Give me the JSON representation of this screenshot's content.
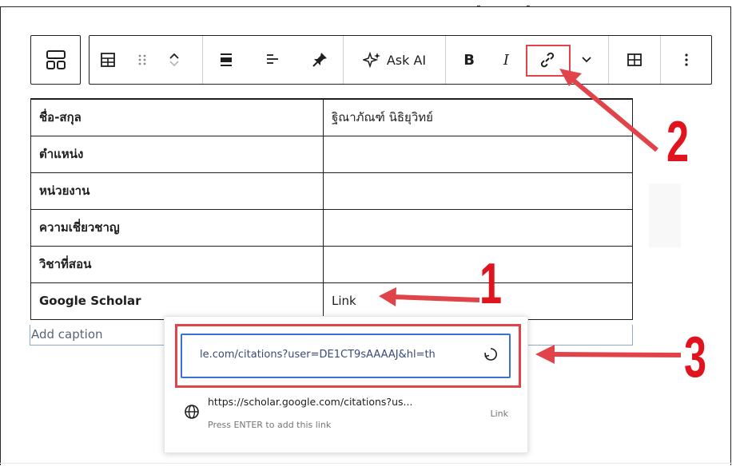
{
  "toolbar": {
    "ask_ai_label": "Ask AI",
    "bold_label": "B",
    "italic_label": "I"
  },
  "table": {
    "rows": [
      {
        "label": "ชื่อ-สกุล",
        "value": "ฐิณาภัณฑ์ นิธิยุวิทย์"
      },
      {
        "label": "ตำแหน่ง",
        "value": ""
      },
      {
        "label": "หน่วยงาน",
        "value": ""
      },
      {
        "label": "ความเชี่ยวชาญ",
        "value": ""
      },
      {
        "label": "วิชาที่สอน",
        "value": ""
      },
      {
        "label": "Google Scholar",
        "value": "Link"
      }
    ],
    "caption_placeholder": "Add caption"
  },
  "link_popover": {
    "url_value": "le.com/citations?user=DE1CT9sAAAAJ&hl=th",
    "suggestion_url": "https://scholar.google.com/citations?us...",
    "suggestion_hint": "Press ENTER to add this link",
    "suggestion_type": "Link"
  },
  "annotations": {
    "step1": "1",
    "step2": "2",
    "step3": "3",
    "color": "#e0141e"
  },
  "top_glyphs": [
    "ๆ",
    "ๆ"
  ]
}
